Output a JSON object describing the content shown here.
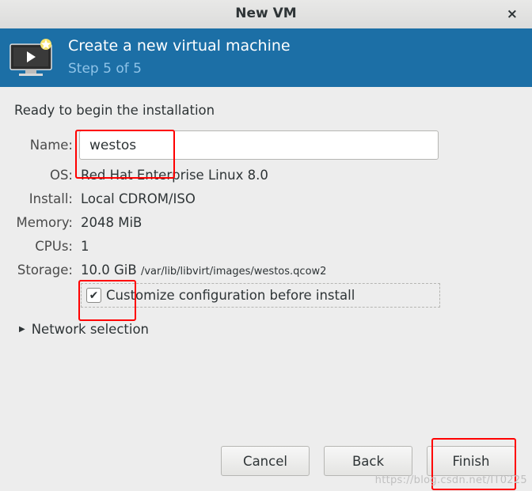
{
  "window": {
    "title": "New VM",
    "close_glyph": "×"
  },
  "banner": {
    "title": "Create a new virtual machine",
    "step": "Step 5 of 5",
    "icon": "virtual-machine-icon",
    "bg_color": "#1c6fa6"
  },
  "summary": {
    "heading": "Ready to begin the installation",
    "name_label": "Name:",
    "name_value": "westos",
    "os_label": "OS:",
    "os_value": "Red Hat Enterprise Linux 8.0",
    "install_label": "Install:",
    "install_value": "Local CDROM/ISO",
    "memory_label": "Memory:",
    "memory_value": "2048 MiB",
    "cpus_label": "CPUs:",
    "cpus_value": "1",
    "storage_label": "Storage:",
    "storage_size": "10.0 GiB",
    "storage_path": "/var/lib/libvirt/images/westos.qcow2"
  },
  "customize": {
    "label": "Customize configuration before install",
    "checked": true
  },
  "network": {
    "label": "Network selection"
  },
  "buttons": {
    "cancel": "Cancel",
    "back": "Back",
    "finish": "Finish"
  },
  "watermark": "https://blog.csdn.net/IT0225",
  "annotation_color": "#ff0000"
}
